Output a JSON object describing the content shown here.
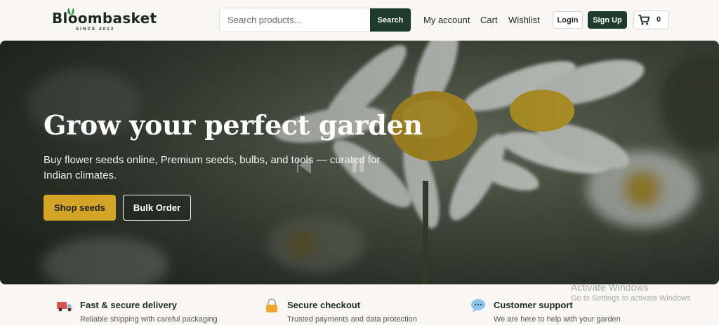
{
  "brand": {
    "name": "Bloombasket",
    "tagline": "SINCE 2012"
  },
  "search": {
    "placeholder": "Search products...",
    "button_label": "Search"
  },
  "nav": {
    "my_account": "My account",
    "cart": "Cart",
    "wishlist": "Wishlist"
  },
  "auth": {
    "login_label": "Login",
    "signup_label": "Sign Up"
  },
  "cart": {
    "count": "0"
  },
  "hero": {
    "title": "Grow your perfect garden",
    "subtitle": "Buy flower seeds online, Premium seeds, bulbs, and tools — curated for Indian climates.",
    "primary_cta": "Shop seeds",
    "secondary_cta": "Bulk Order"
  },
  "features": [
    {
      "icon": "delivery-truck-icon",
      "title": "Fast & secure delivery",
      "desc": "Reliable shipping with careful packaging"
    },
    {
      "icon": "lock-icon",
      "title": "Secure checkout",
      "desc": "Trusted payments and data protection"
    },
    {
      "icon": "chat-bubble-icon",
      "title": "Customer support",
      "desc": "We are here to help with your garden"
    }
  ],
  "os_watermark": {
    "title": "Activate Windows",
    "subtitle": "Go to Settings to activate Windows"
  },
  "colors": {
    "primary_green": "#1d3a2c",
    "accent_gold": "#d4a427",
    "page_bg": "#f8f7f3"
  }
}
